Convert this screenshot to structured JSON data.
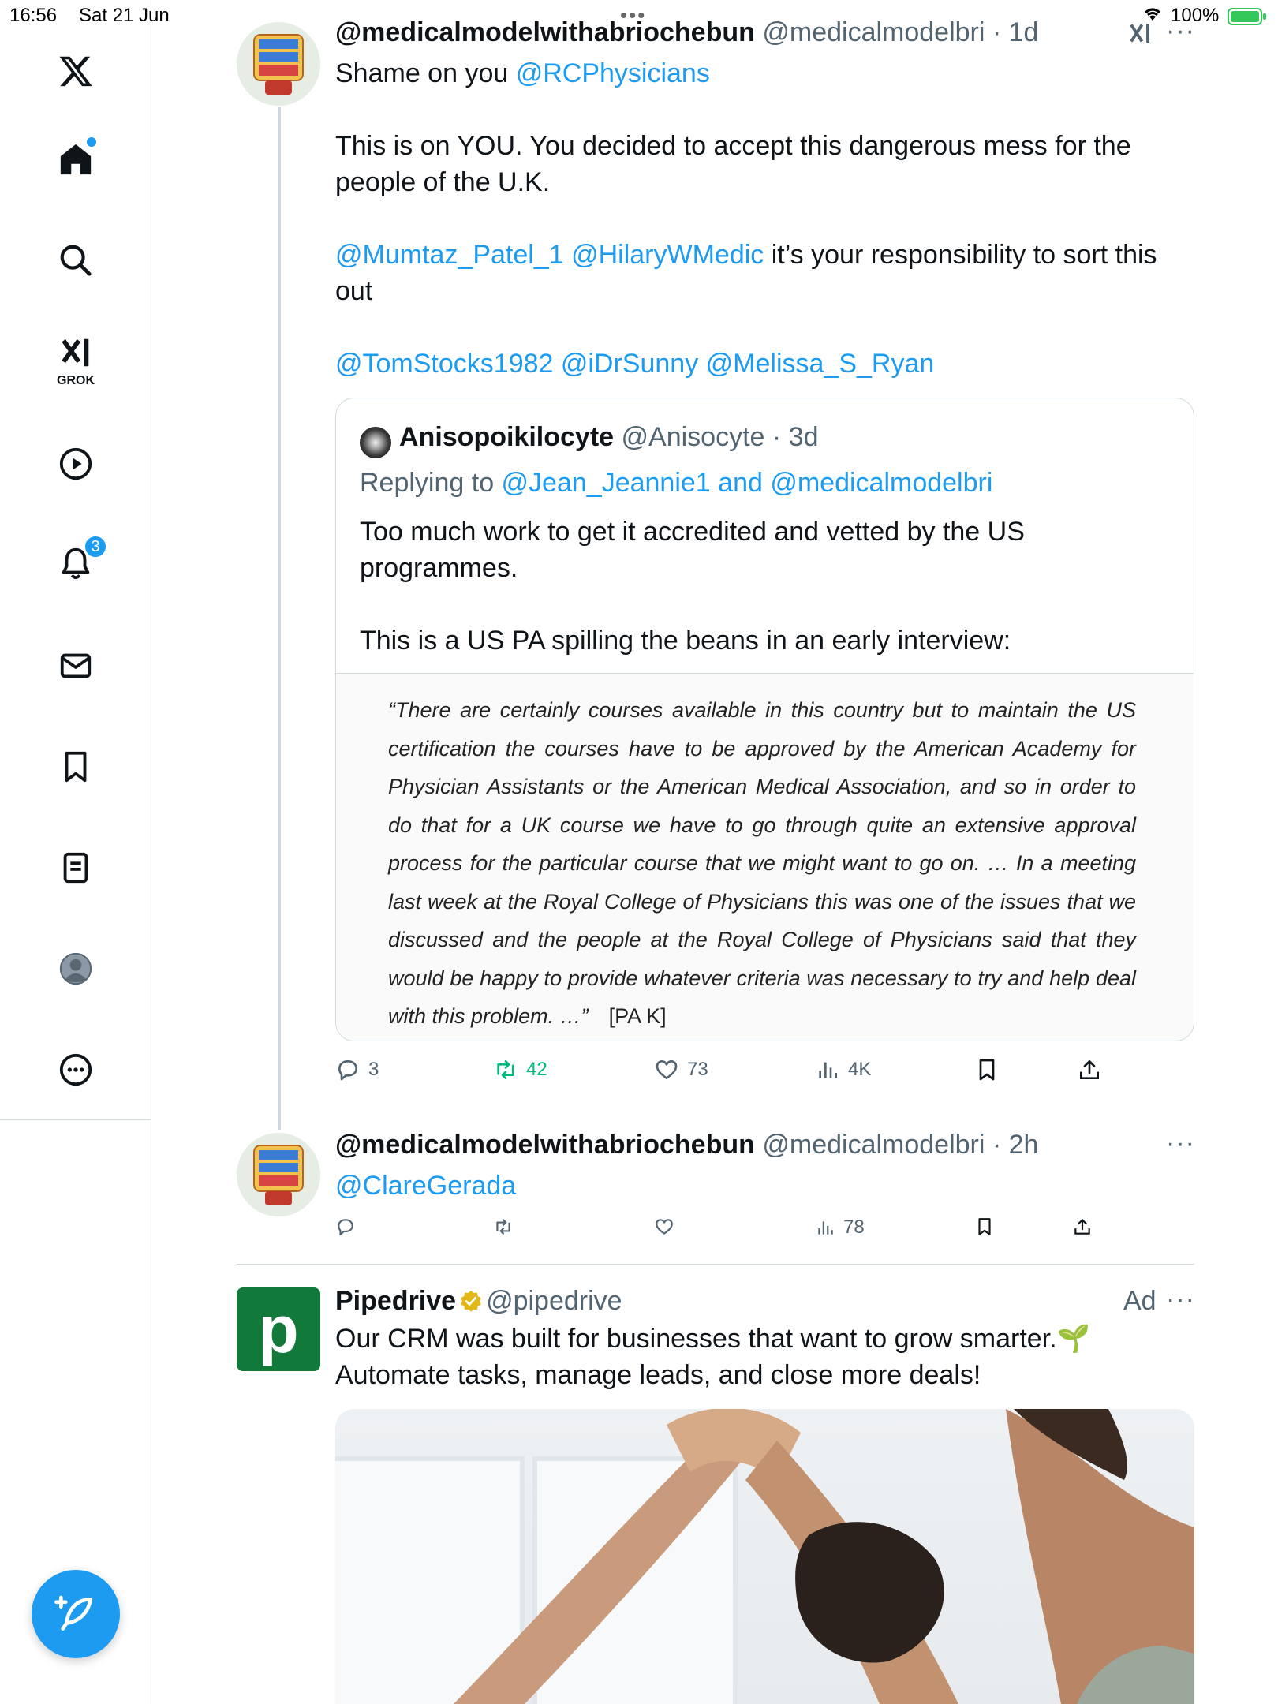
{
  "status_bar": {
    "time": "16:56",
    "date": "Sat 21 Jun",
    "battery": "100%",
    "multitask_dots": "•••"
  },
  "nav": {
    "items": [
      {
        "name": "home",
        "icon": "home-icon",
        "has_dot": true
      },
      {
        "name": "explore",
        "icon": "search-icon"
      },
      {
        "name": "grok",
        "icon": "grok-icon",
        "label": "GROK"
      },
      {
        "name": "videos",
        "icon": "play-icon"
      },
      {
        "name": "notifications",
        "icon": "bell-icon",
        "badge": "3"
      },
      {
        "name": "messages",
        "icon": "mail-icon"
      },
      {
        "name": "bookmarks",
        "icon": "bookmark-icon"
      },
      {
        "name": "lists",
        "icon": "list-icon"
      },
      {
        "name": "profile",
        "icon": "profile-icon"
      },
      {
        "name": "more",
        "icon": "more-circle-icon"
      }
    ],
    "accent": "#1d9bf0"
  },
  "tweet1": {
    "name": "@medicalmodelwithabriochebun",
    "handle": "@medicalmodelbri",
    "time": "1d",
    "para1_prefix": "Shame on you ",
    "para1_mention": "@RCPhysicians",
    "para2": "This is on YOU. You decided to accept this dangerous mess for the people of the U.K.",
    "para3_mentions": "@Mumtaz_Patel_1 @HilaryWMedic",
    "para3_text": " it’s your responsibility to sort this out",
    "para4_mentions": "@TomStocks1982 @iDrSunny @Melissa_S_Ryan",
    "quote": {
      "name": "Anisopoikilocyte",
      "handle": "@Anisocyte",
      "time": "3d",
      "replying_prefix": "Replying to ",
      "replying_to": "@Jean_Jeannie1 and @medicalmodelbri",
      "text1": "Too much work to get it accredited and vetted by the US programmes.",
      "text2": "This is a US PA spilling the beans in an early interview:",
      "image_quote": "“There are certainly courses available in this country but to maintain the US certification the courses have to be approved by the American Academy for Physician Assistants or the American Medical Association, and so in order to do that for a UK course we have to go through quite an extensive approval process for the particular course that we might want to go on.  … In a meeting last week at the Royal College of Physicians this was one of the issues that we discussed and the people at the Royal College of Physicians said that they would be happy to provide whatever criteria was necessary to try and help deal with this problem. …”",
      "image_tag": "[PA K]"
    },
    "stats": {
      "replies": "3",
      "reposts": "42",
      "likes": "73",
      "views": "4K"
    }
  },
  "tweet2": {
    "name": "@medicalmodelwithabriochebun",
    "handle": "@medicalmodelbri",
    "time": "2h",
    "mention": "@ClareGerada",
    "stats": {
      "views": "78"
    }
  },
  "ad": {
    "name": "Pipedrive",
    "handle": "@pipedrive",
    "label": "Ad",
    "logo_letter": "p",
    "line1": "Our CRM was built for businesses that want to grow smarter.🌱",
    "line2": "Automate tasks, manage leads, and close more deals!",
    "brand_color": "#117a3a"
  },
  "more_glyph": "···",
  "separator": " · "
}
